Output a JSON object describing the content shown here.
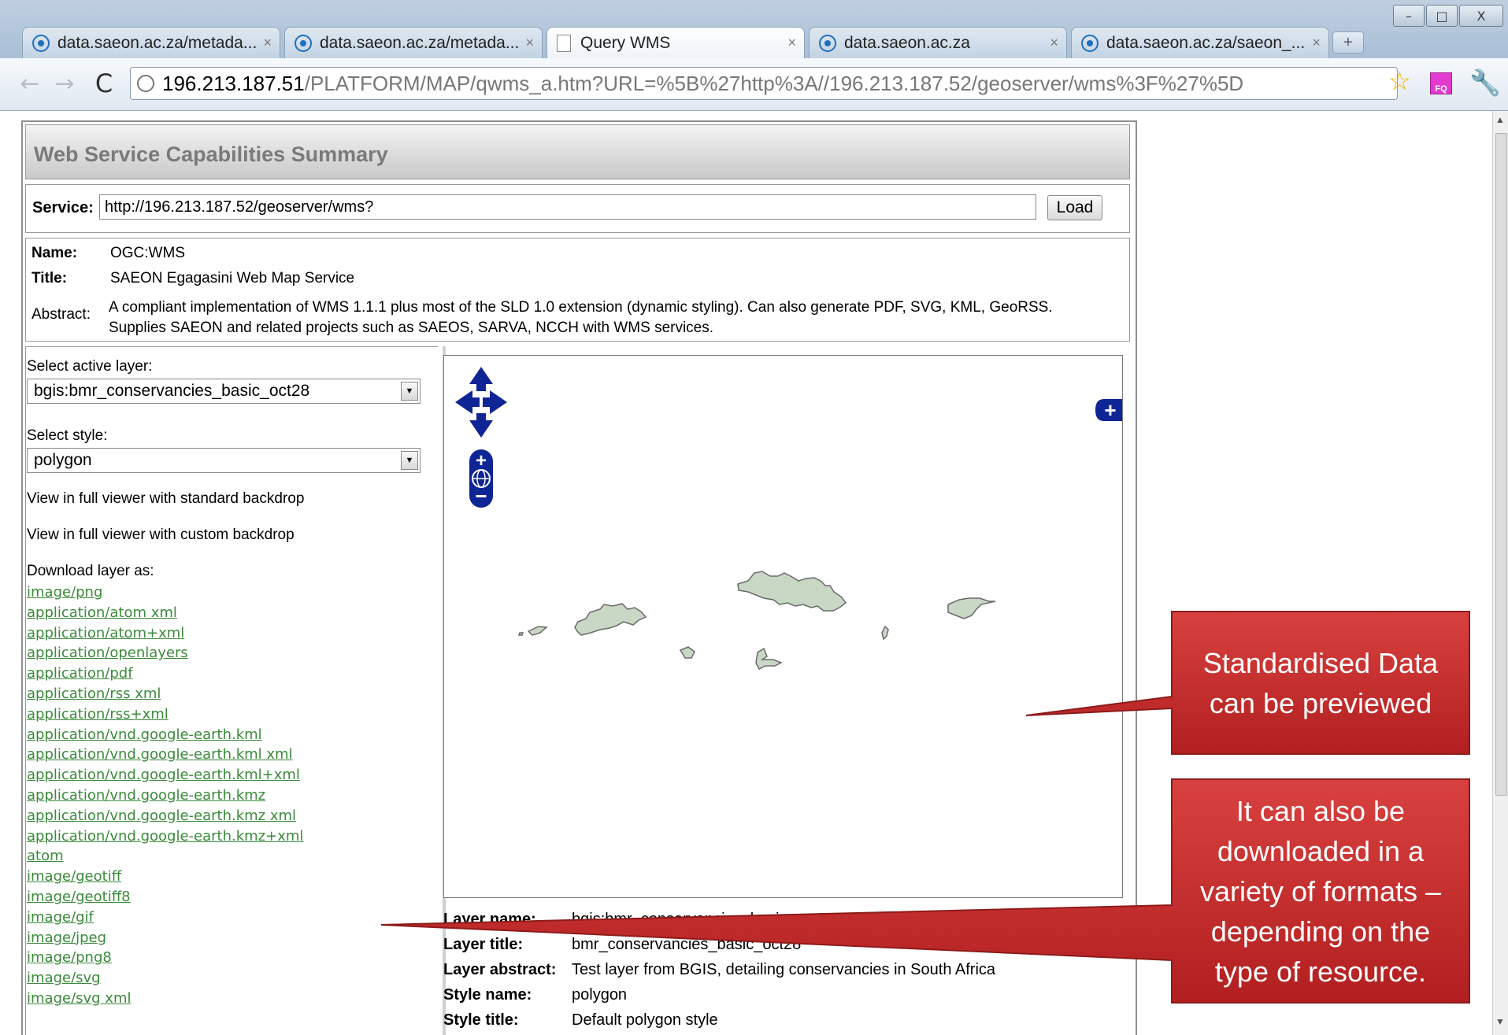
{
  "browser": {
    "tabs": [
      {
        "title": "data.saeon.ac.za/metada...",
        "icon": "saeon-favicon-icon"
      },
      {
        "title": "data.saeon.ac.za/metada...",
        "icon": "saeon-favicon-icon"
      },
      {
        "title": "Query WMS",
        "icon": "page-icon"
      },
      {
        "title": "data.saeon.ac.za",
        "icon": "saeon-favicon-icon"
      },
      {
        "title": "data.saeon.ac.za/saeon_...",
        "icon": "saeon-favicon-icon"
      }
    ],
    "active_tab": 2,
    "close_glyph": "×",
    "new_tab_glyph": "+",
    "window_buttons": {
      "minimize": "–",
      "maximize": "□",
      "close": "X"
    },
    "nav": {
      "back": "←",
      "forward": "→",
      "reload": "C"
    },
    "url_host": "196.213.187.51",
    "url_path": "/PLATFORM/MAP/qwms_a.htm?URL=%5B%27http%3A//196.213.187.52/geoserver/wms%3F%27%5D",
    "star_glyph": "☆",
    "extension_label": "FQ",
    "wrench_glyph": "🔧"
  },
  "page": {
    "header_title": "Web Service Capabilities Summary",
    "service_label": "Service:",
    "service_url": "http://196.213.187.52/geoserver/wms?",
    "load_button": "Load",
    "info": {
      "name_key": "Name:",
      "name_value": "OGC:WMS",
      "title_key": "Title:",
      "title_value": "SAEON Egagasini Web Map Service",
      "abstract_key": "Abstract:",
      "abstract_value": "A compliant implementation of WMS 1.1.1 plus most of the SLD 1.0 extension (dynamic styling). Can also generate PDF, SVG, KML, GeoRSS. Supplies SAEON and related projects such as SAEOS, SARVA, NCCH with WMS services."
    },
    "select_layer_label": "Select active layer:",
    "selected_layer": "bgis:bmr_conservancies_basic_oct28",
    "select_style_label": "Select style:",
    "selected_style": "polygon",
    "view_standard": "View in full viewer with standard backdrop",
    "view_custom": "View in full viewer with custom backdrop",
    "download_label": "Download layer as:",
    "download_formats": [
      "image/png",
      "application/atom xml",
      "application/atom+xml",
      "application/openlayers",
      "application/pdf",
      "application/rss xml",
      "application/rss+xml",
      "application/vnd.google-earth.kml",
      "application/vnd.google-earth.kml xml",
      "application/vnd.google-earth.kml+xml",
      "application/vnd.google-earth.kmz",
      "application/vnd.google-earth.kmz xml",
      "application/vnd.google-earth.kmz+xml",
      "atom",
      "image/geotiff",
      "image/geotiff8",
      "image/gif",
      "image/jpeg",
      "image/png8",
      "image/svg",
      "image/svg xml"
    ],
    "map": {
      "pan_icon": "pan-arrows-icon",
      "zoom_in": "+",
      "zoom_out": "−",
      "layer_switcher": "+",
      "polygon_fill": "#c8d8c4",
      "polygon_stroke": "#6a6a6a",
      "control_color": "#0f2596"
    },
    "layer_meta": {
      "layer_name_key": "Layer name:",
      "layer_name_value": "bgis:bmr_conservancies_basic_oct28",
      "layer_title_key": "Layer title:",
      "layer_title_value": "bmr_conservancies_basic_oct28",
      "layer_abstract_key": "Layer abstract:",
      "layer_abstract_value": "Test layer from BGIS, detailing conservancies in South Africa",
      "style_name_key": "Style name:",
      "style_name_value": "polygon",
      "style_title_key": "Style title:",
      "style_title_value": "Default polygon style"
    }
  },
  "callouts": {
    "preview_line1": "Standardised Data",
    "preview_line2": "can be previewed",
    "download_line1": "It can also be",
    "download_line2": "downloaded in a",
    "download_line3": "variety of formats –",
    "download_line4": "depending on the",
    "download_line5": "type of resource.",
    "fill_color": "#c8292a"
  }
}
